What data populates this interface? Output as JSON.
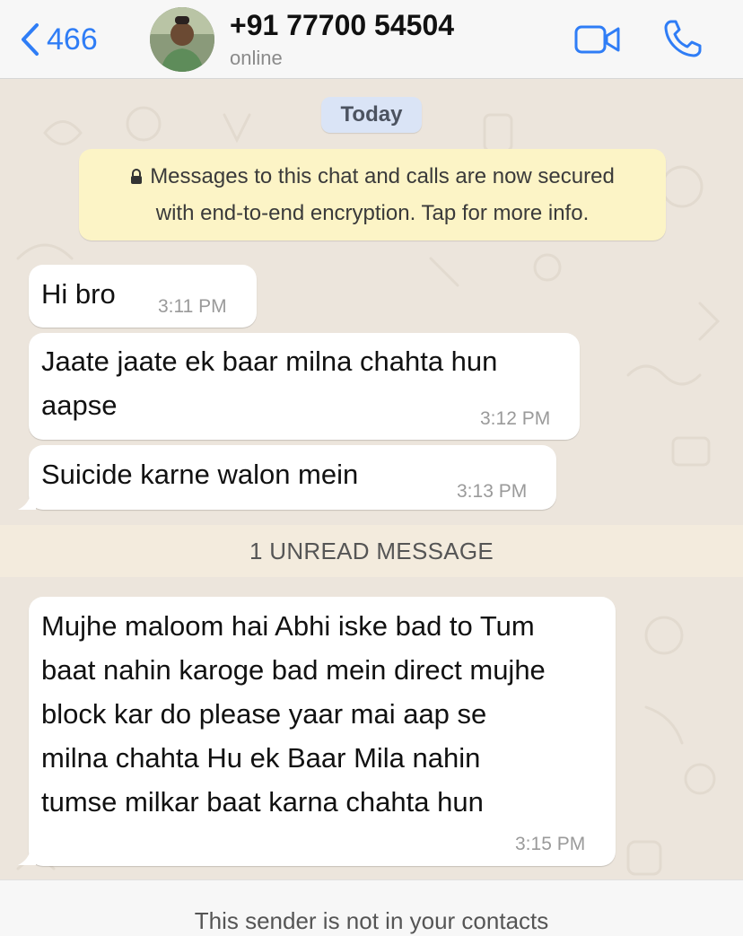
{
  "header": {
    "back_count": "466",
    "contact_name": "+91 77700 54504",
    "status": "online",
    "icons": {
      "back": "chevron-left-icon",
      "video": "video-camera-icon",
      "call": "phone-icon"
    }
  },
  "chat": {
    "date_label": "Today",
    "encryption_notice": {
      "line1": "Messages to this chat and calls are now secured",
      "line2": "with end-to-end encryption. Tap for more info."
    },
    "messages": [
      {
        "lines": [
          "Hi bro"
        ],
        "time": "3:11 PM"
      },
      {
        "lines": [
          "Jaate jaate ek baar milna chahta hun",
          "aapse"
        ],
        "time": "3:12 PM"
      },
      {
        "lines": [
          "Suicide karne walon mein"
        ],
        "time": "3:13 PM"
      },
      {
        "lines": [
          "Mujhe maloom hai Abhi iske bad to Tum",
          "baat nahin karoge bad mein direct mujhe",
          "block kar do please yaar mai aap se",
          "milna chahta Hu ek Baar Mila nahin",
          "tumse milkar baat karna chahta hun"
        ],
        "time": "3:15 PM"
      }
    ],
    "unread_label": "1 UNREAD MESSAGE"
  },
  "footer": {
    "text": "This sender is not in your contacts"
  },
  "colors": {
    "accent": "#2f7df6",
    "chat_bg": "#ece5dc",
    "notice_bg": "#fcf4c6",
    "date_pill_bg": "#dae4f6"
  }
}
